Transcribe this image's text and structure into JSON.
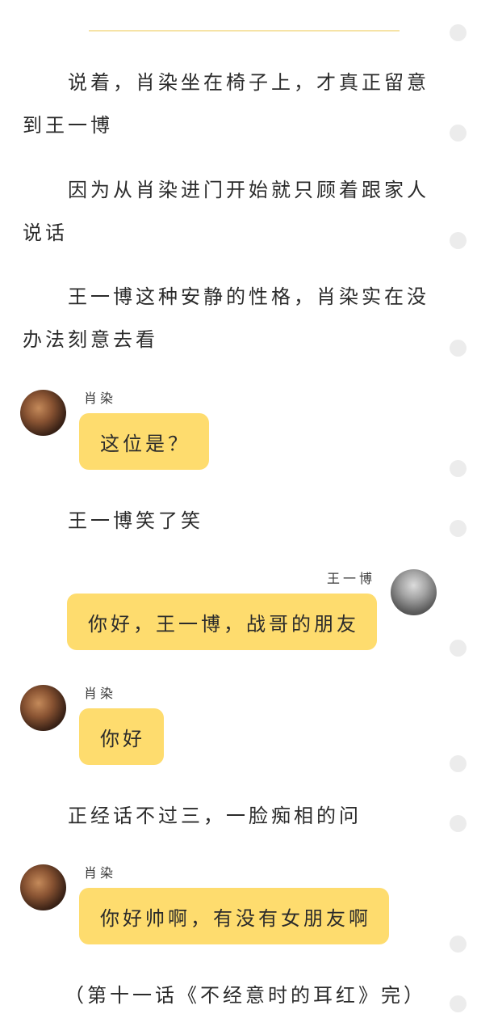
{
  "story": {
    "paragraphs": [
      "说着，肖染坐在椅子上，才真正留意到王一博",
      "因为从肖染进门开始就只顾着跟家人说话",
      "王一博这种安静的性格，肖染实在没办法刻意去看"
    ],
    "narration_1": "王一博笑了笑",
    "narration_2": "正经话不过三，一脸痴相的问",
    "ending": "（第十一话《不经意时的耳红》完）"
  },
  "messages": [
    {
      "speaker": "肖染",
      "text": "这位是？",
      "side": "left"
    },
    {
      "speaker": "王一博",
      "text": "你好，王一博，战哥的朋友",
      "side": "right"
    },
    {
      "speaker": "肖染",
      "text": "你好",
      "side": "left"
    },
    {
      "speaker": "肖染",
      "text": "你好帅啊，有没有女朋友啊",
      "side": "left"
    }
  ],
  "colors": {
    "bubble": "#fedc6e",
    "divider": "#f6e3a6",
    "scroll_dot": "#ececec"
  },
  "icons": {
    "avatar_xiao_ran": "avatar-photo-xiao-ran",
    "avatar_wang_yibo": "avatar-photo-wang-yibo"
  }
}
